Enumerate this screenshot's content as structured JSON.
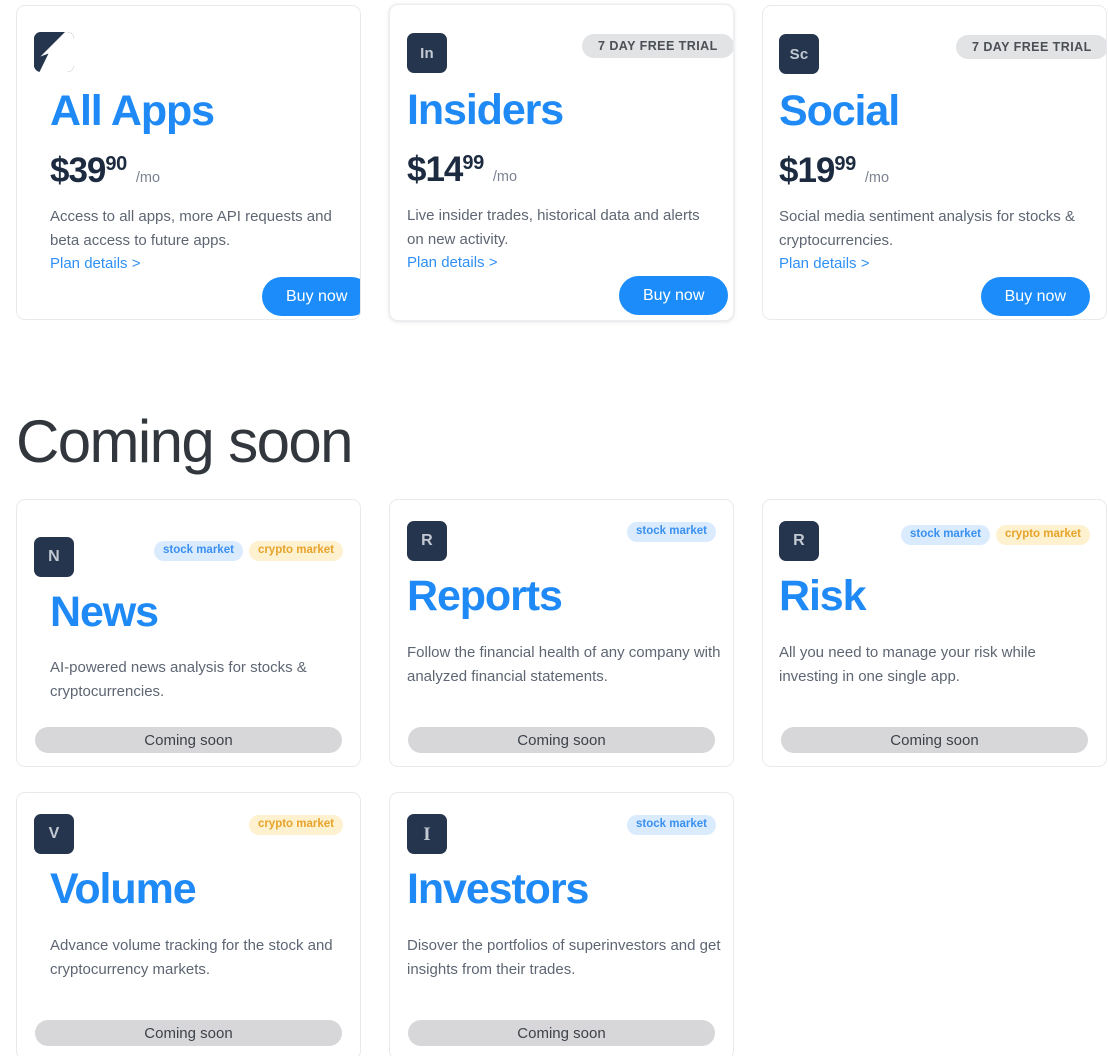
{
  "section": {
    "coming_soon_heading": "Coming soon"
  },
  "plans": [
    {
      "icon_label": "All Apps logo",
      "icon_type": "logo",
      "title": "All Apps",
      "price_main": "$39",
      "price_cents": "90",
      "price_period": "/mo",
      "description": "Access to all apps, more API requests and beta access to future apps.",
      "plan_details_label": "Plan details >",
      "buy_label": "Buy now",
      "trial_badge": ""
    },
    {
      "icon_label": "In",
      "icon_type": "letters",
      "title": "Insiders",
      "price_main": "$14",
      "price_cents": "99",
      "price_period": "/mo",
      "description": "Live insider trades, historical data and alerts on new activity.",
      "plan_details_label": "Plan details >",
      "buy_label": "Buy now",
      "trial_badge": "7 DAY FREE TRIAL"
    },
    {
      "icon_label": "Sc",
      "icon_type": "letters",
      "title": "Social",
      "price_main": "$19",
      "price_cents": "99",
      "price_period": "/mo",
      "description": "Social media sentiment analysis for stocks & cryptocurrencies.",
      "plan_details_label": "Plan details >",
      "buy_label": "Buy now",
      "trial_badge": "7 DAY FREE TRIAL"
    }
  ],
  "upcoming": [
    {
      "icon_label": "N",
      "title": "News",
      "description": "AI-powered news analysis for stocks & cryptocurrencies.",
      "tags": [
        "stock market",
        "crypto market"
      ],
      "button_label": "Coming soon"
    },
    {
      "icon_label": "R",
      "title": "Reports",
      "description": "Follow the financial health of any company with analyzed financial statements.",
      "tags": [
        "stock market"
      ],
      "button_label": "Coming soon"
    },
    {
      "icon_label": "R",
      "title": "Risk",
      "description": "All you need to manage your risk while investing in one single app.",
      "tags": [
        "stock market",
        "crypto market"
      ],
      "button_label": "Coming soon"
    },
    {
      "icon_label": "V",
      "title": "Volume",
      "description": "Advance volume tracking for the stock and cryptocurrency markets.",
      "tags": [
        "crypto market"
      ],
      "button_label": "Coming soon"
    },
    {
      "icon_label": "I",
      "title": "Investors",
      "description": "Disover the portfolios of superinvestors and get insights from their trades.",
      "tags": [
        "stock market"
      ],
      "button_label": "Coming soon"
    }
  ],
  "colors": {
    "accent_blue": "#1f8af5",
    "icon_navy": "#25354d",
    "tag_stock_bg": "#d9ebfd",
    "tag_stock_text": "#3a90ef",
    "tag_crypto_bg": "#fdf1cf",
    "tag_crypto_text": "#e7a32b",
    "coming_soon_bg": "#d7d7d9",
    "trial_badge_bg": "#e2e3e5"
  }
}
